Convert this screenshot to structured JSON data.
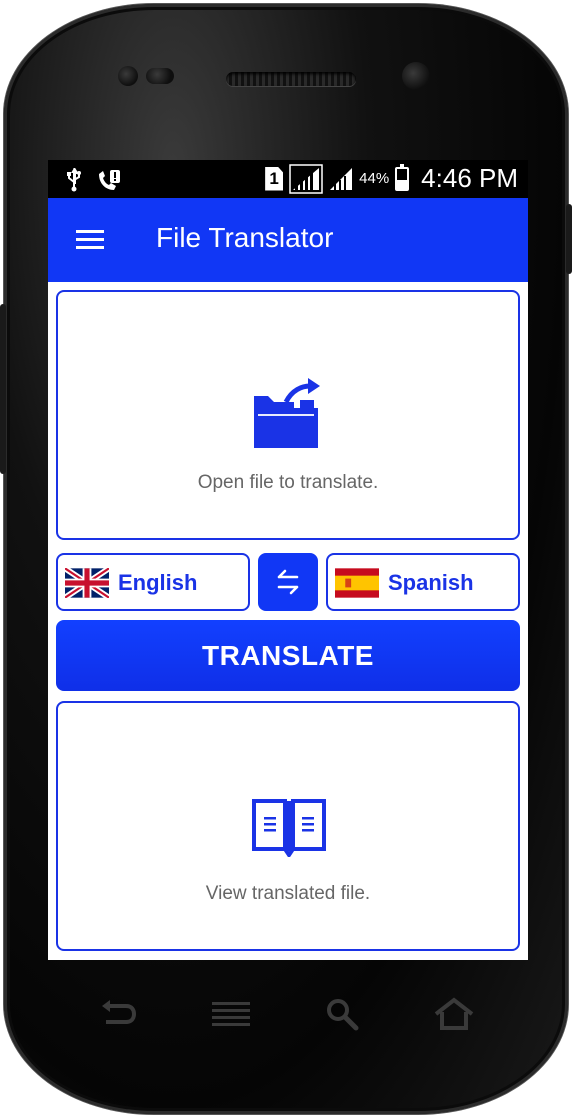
{
  "status_bar": {
    "sim_slot": "1",
    "battery_percent": "44%",
    "battery_level": 0.44,
    "time": "4:46 PM"
  },
  "app_bar": {
    "title": "File Translator",
    "menu_icon": "hamburger-menu-icon"
  },
  "open_file_card": {
    "icon": "open-folder-icon",
    "label": "Open file to translate."
  },
  "languages": {
    "source": {
      "label": "English",
      "flag": "uk-flag-icon"
    },
    "target": {
      "label": "Spanish",
      "flag": "spain-flag-icon"
    },
    "swap_icon": "swap-arrows-icon"
  },
  "translate_button": {
    "label": "TRANSLATE"
  },
  "view_file_card": {
    "icon": "open-book-icon",
    "label": "View translated file."
  },
  "colors": {
    "primary": "#1137f5",
    "border": "#1a33e6",
    "muted_text": "#666666"
  },
  "hardware_keys": [
    "back-icon",
    "menu-icon",
    "search-icon",
    "home-icon"
  ]
}
